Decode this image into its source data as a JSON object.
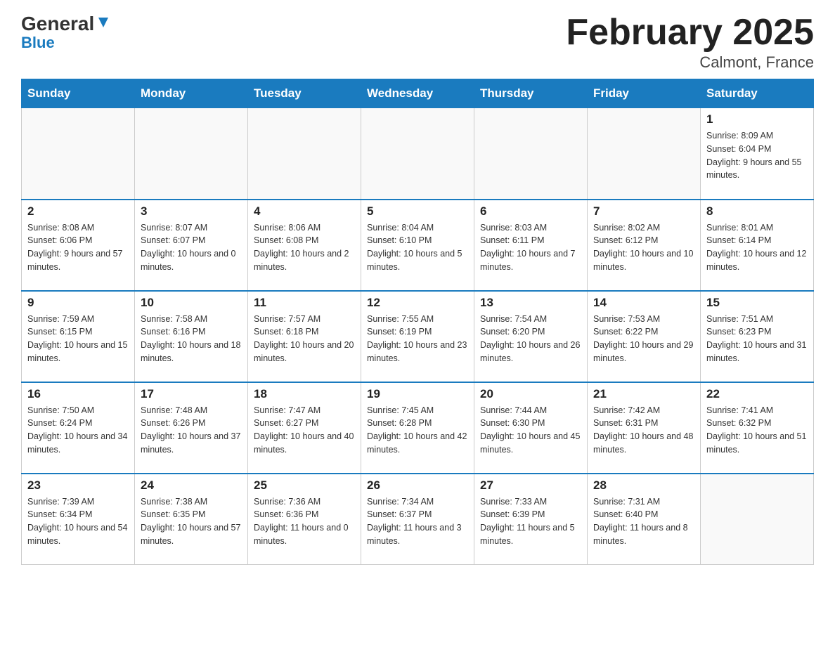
{
  "logo": {
    "text_general": "General",
    "text_blue": "Blue",
    "arrow": "▲"
  },
  "title": "February 2025",
  "location": "Calmont, France",
  "days_of_week": [
    "Sunday",
    "Monday",
    "Tuesday",
    "Wednesday",
    "Thursday",
    "Friday",
    "Saturday"
  ],
  "weeks": [
    [
      {
        "day": "",
        "info": ""
      },
      {
        "day": "",
        "info": ""
      },
      {
        "day": "",
        "info": ""
      },
      {
        "day": "",
        "info": ""
      },
      {
        "day": "",
        "info": ""
      },
      {
        "day": "",
        "info": ""
      },
      {
        "day": "1",
        "info": "Sunrise: 8:09 AM\nSunset: 6:04 PM\nDaylight: 9 hours and 55 minutes."
      }
    ],
    [
      {
        "day": "2",
        "info": "Sunrise: 8:08 AM\nSunset: 6:06 PM\nDaylight: 9 hours and 57 minutes."
      },
      {
        "day": "3",
        "info": "Sunrise: 8:07 AM\nSunset: 6:07 PM\nDaylight: 10 hours and 0 minutes."
      },
      {
        "day": "4",
        "info": "Sunrise: 8:06 AM\nSunset: 6:08 PM\nDaylight: 10 hours and 2 minutes."
      },
      {
        "day": "5",
        "info": "Sunrise: 8:04 AM\nSunset: 6:10 PM\nDaylight: 10 hours and 5 minutes."
      },
      {
        "day": "6",
        "info": "Sunrise: 8:03 AM\nSunset: 6:11 PM\nDaylight: 10 hours and 7 minutes."
      },
      {
        "day": "7",
        "info": "Sunrise: 8:02 AM\nSunset: 6:12 PM\nDaylight: 10 hours and 10 minutes."
      },
      {
        "day": "8",
        "info": "Sunrise: 8:01 AM\nSunset: 6:14 PM\nDaylight: 10 hours and 12 minutes."
      }
    ],
    [
      {
        "day": "9",
        "info": "Sunrise: 7:59 AM\nSunset: 6:15 PM\nDaylight: 10 hours and 15 minutes."
      },
      {
        "day": "10",
        "info": "Sunrise: 7:58 AM\nSunset: 6:16 PM\nDaylight: 10 hours and 18 minutes."
      },
      {
        "day": "11",
        "info": "Sunrise: 7:57 AM\nSunset: 6:18 PM\nDaylight: 10 hours and 20 minutes."
      },
      {
        "day": "12",
        "info": "Sunrise: 7:55 AM\nSunset: 6:19 PM\nDaylight: 10 hours and 23 minutes."
      },
      {
        "day": "13",
        "info": "Sunrise: 7:54 AM\nSunset: 6:20 PM\nDaylight: 10 hours and 26 minutes."
      },
      {
        "day": "14",
        "info": "Sunrise: 7:53 AM\nSunset: 6:22 PM\nDaylight: 10 hours and 29 minutes."
      },
      {
        "day": "15",
        "info": "Sunrise: 7:51 AM\nSunset: 6:23 PM\nDaylight: 10 hours and 31 minutes."
      }
    ],
    [
      {
        "day": "16",
        "info": "Sunrise: 7:50 AM\nSunset: 6:24 PM\nDaylight: 10 hours and 34 minutes."
      },
      {
        "day": "17",
        "info": "Sunrise: 7:48 AM\nSunset: 6:26 PM\nDaylight: 10 hours and 37 minutes."
      },
      {
        "day": "18",
        "info": "Sunrise: 7:47 AM\nSunset: 6:27 PM\nDaylight: 10 hours and 40 minutes."
      },
      {
        "day": "19",
        "info": "Sunrise: 7:45 AM\nSunset: 6:28 PM\nDaylight: 10 hours and 42 minutes."
      },
      {
        "day": "20",
        "info": "Sunrise: 7:44 AM\nSunset: 6:30 PM\nDaylight: 10 hours and 45 minutes."
      },
      {
        "day": "21",
        "info": "Sunrise: 7:42 AM\nSunset: 6:31 PM\nDaylight: 10 hours and 48 minutes."
      },
      {
        "day": "22",
        "info": "Sunrise: 7:41 AM\nSunset: 6:32 PM\nDaylight: 10 hours and 51 minutes."
      }
    ],
    [
      {
        "day": "23",
        "info": "Sunrise: 7:39 AM\nSunset: 6:34 PM\nDaylight: 10 hours and 54 minutes."
      },
      {
        "day": "24",
        "info": "Sunrise: 7:38 AM\nSunset: 6:35 PM\nDaylight: 10 hours and 57 minutes."
      },
      {
        "day": "25",
        "info": "Sunrise: 7:36 AM\nSunset: 6:36 PM\nDaylight: 11 hours and 0 minutes."
      },
      {
        "day": "26",
        "info": "Sunrise: 7:34 AM\nSunset: 6:37 PM\nDaylight: 11 hours and 3 minutes."
      },
      {
        "day": "27",
        "info": "Sunrise: 7:33 AM\nSunset: 6:39 PM\nDaylight: 11 hours and 5 minutes."
      },
      {
        "day": "28",
        "info": "Sunrise: 7:31 AM\nSunset: 6:40 PM\nDaylight: 11 hours and 8 minutes."
      },
      {
        "day": "",
        "info": ""
      }
    ]
  ]
}
